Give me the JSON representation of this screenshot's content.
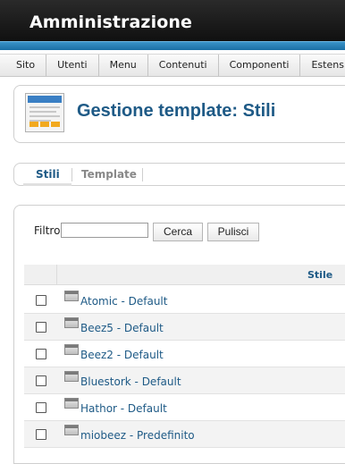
{
  "header": {
    "title": "Amministrazione"
  },
  "menu": [
    "Sito",
    "Utenti",
    "Menu",
    "Contenuti",
    "Componenti",
    "Estensioni"
  ],
  "page": {
    "title": "Gestione template: Stili"
  },
  "tabs": [
    {
      "label": "Stili",
      "active": true
    },
    {
      "label": "Template",
      "active": false
    }
  ],
  "filter": {
    "label": "Filtro:",
    "value": "",
    "search_button": "Cerca",
    "clear_button": "Pulisci"
  },
  "table": {
    "column_header": "Stile",
    "rows": [
      {
        "name": "Atomic - Default"
      },
      {
        "name": "Beez5 - Default"
      },
      {
        "name": "Beez2 - Default"
      },
      {
        "name": "Bluestork - Default"
      },
      {
        "name": "Hathor - Default"
      },
      {
        "name": "miobeez - Predefinito"
      }
    ]
  },
  "colors": {
    "header_bg": "#111111",
    "accent_blue": "#2a83bd",
    "title_blue": "#1e5a86"
  }
}
